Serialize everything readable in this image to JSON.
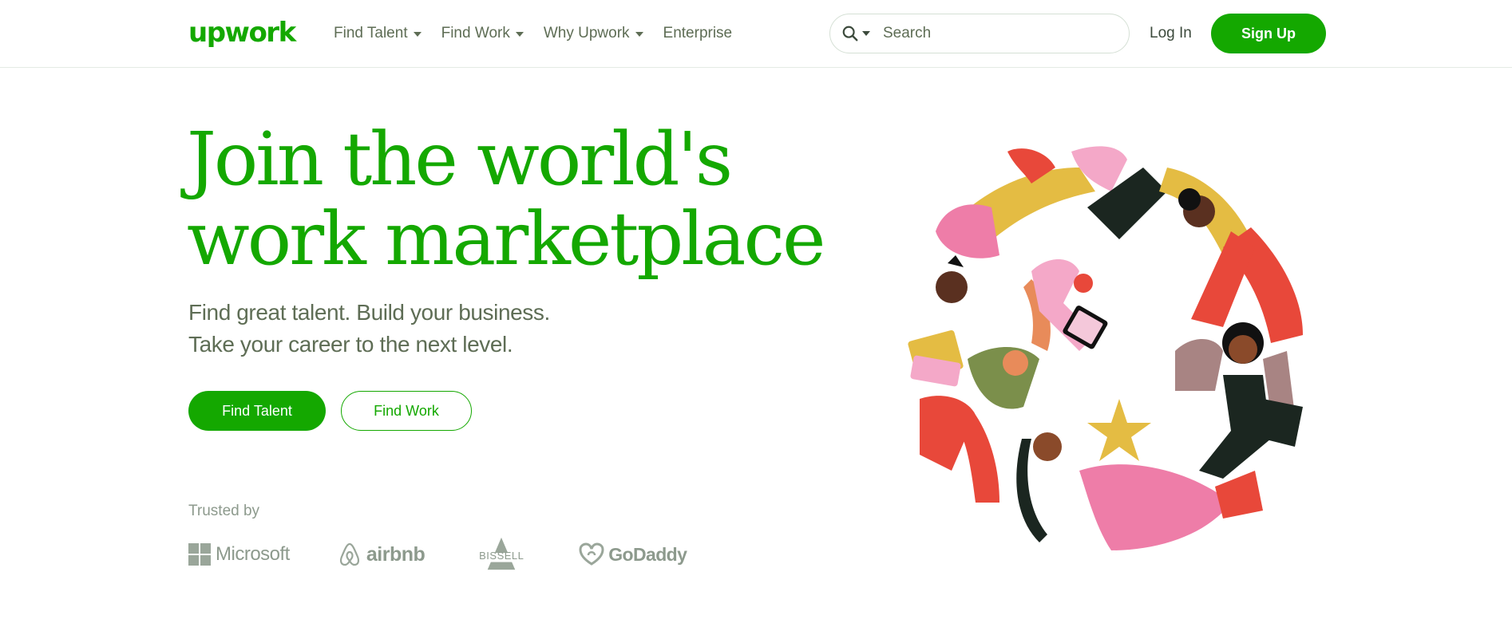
{
  "header": {
    "logo_text": "upwork",
    "nav": [
      {
        "label": "Find Talent",
        "dropdown": true
      },
      {
        "label": "Find Work",
        "dropdown": true
      },
      {
        "label": "Why Upwork",
        "dropdown": true
      },
      {
        "label": "Enterprise",
        "dropdown": false
      }
    ],
    "search": {
      "placeholder": "Search",
      "value": ""
    },
    "login_label": "Log In",
    "signup_label": "Sign Up"
  },
  "hero": {
    "headline_line1": "Join the world's",
    "headline_line2": "work marketplace",
    "sub_line1": "Find great talent. Build your business.",
    "sub_line2": "Take your career to the next level.",
    "primary_cta": "Find Talent",
    "secondary_cta": "Find Work"
  },
  "trusted": {
    "label": "Trusted by",
    "brands": [
      "Microsoft",
      "airbnb",
      "BISSELL",
      "GoDaddy"
    ]
  },
  "colors": {
    "brand_green": "#14a800",
    "text_dark": "#3c4a3c",
    "text_muted": "#5e6d55",
    "logo_gray": "#8d9a8d"
  },
  "icons": {
    "search": "search-icon",
    "caret": "chevron-down-icon"
  }
}
